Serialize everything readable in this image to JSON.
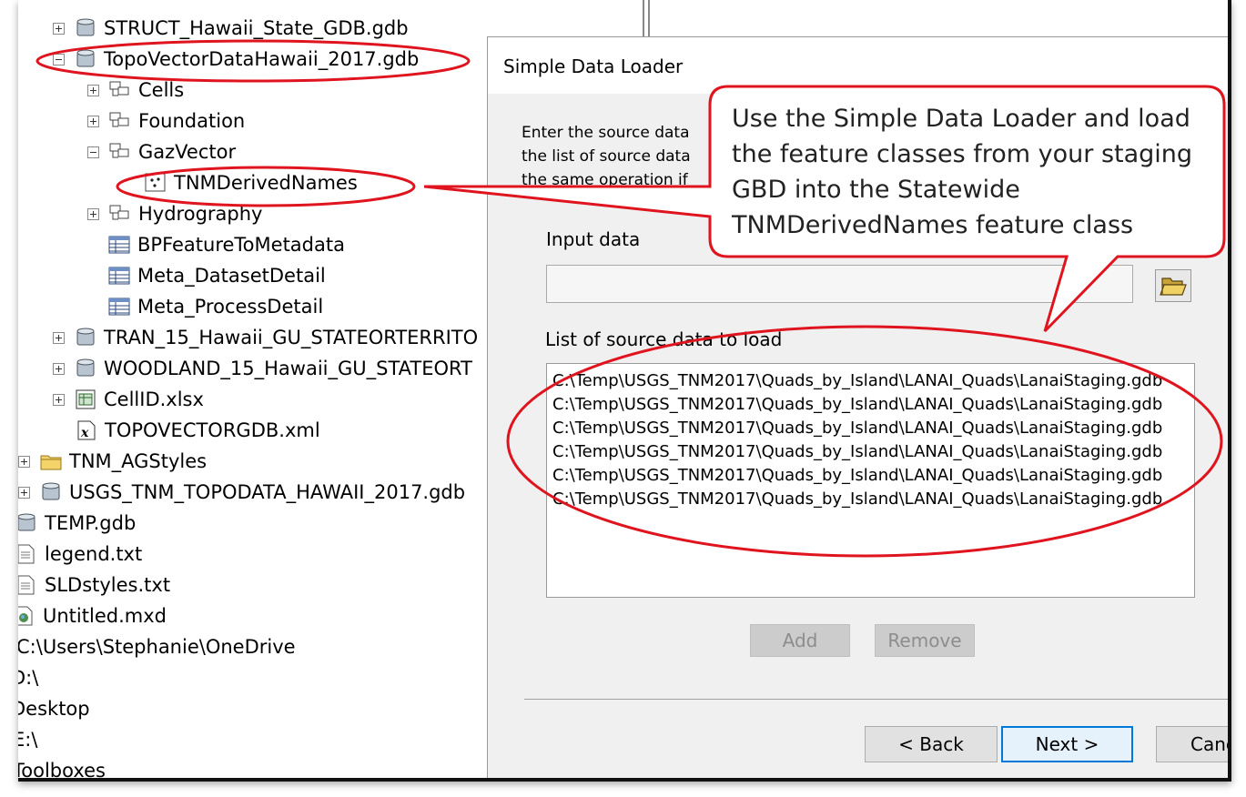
{
  "tree": {
    "items": [
      {
        "label": "STRUCT_Hawaii_State_GDB.gdb",
        "expander": "plus",
        "icon": "geodatabase-icon"
      },
      {
        "label": "TopoVectorDataHawaii_2017.gdb",
        "expander": "minus",
        "icon": "geodatabase-icon"
      },
      {
        "label": "Cells",
        "expander": "plus",
        "icon": "feature-dataset-icon"
      },
      {
        "label": "Foundation",
        "expander": "plus",
        "icon": "feature-dataset-icon"
      },
      {
        "label": "GazVector",
        "expander": "minus",
        "icon": "feature-dataset-icon"
      },
      {
        "label": "TNMDerivedNames",
        "expander": "none",
        "icon": "point-feature-class-icon"
      },
      {
        "label": "Hydrography",
        "expander": "plus",
        "icon": "feature-dataset-icon"
      },
      {
        "label": "BPFeatureToMetadata",
        "expander": "none",
        "icon": "table-icon"
      },
      {
        "label": "Meta_DatasetDetail",
        "expander": "none",
        "icon": "table-icon"
      },
      {
        "label": "Meta_ProcessDetail",
        "expander": "none",
        "icon": "table-icon"
      },
      {
        "label": "TRAN_15_Hawaii_GU_STATEORTERRITO",
        "expander": "plus",
        "icon": "geodatabase-icon"
      },
      {
        "label": "WOODLAND_15_Hawaii_GU_STATEORT",
        "expander": "plus",
        "icon": "geodatabase-icon"
      },
      {
        "label": "CellID.xlsx",
        "expander": "plus",
        "icon": "excel-file-icon"
      },
      {
        "label": "TOPOVECTORGDB.xml",
        "expander": "none",
        "icon": "xml-file-icon"
      },
      {
        "label": "TNM_AGStyles",
        "expander": "plus",
        "icon": "folder-icon"
      },
      {
        "label": "USGS_TNM_TOPODATA_HAWAII_2017.gdb",
        "expander": "plus",
        "icon": "geodatabase-icon"
      },
      {
        "label": "TEMP.gdb",
        "expander": "none",
        "icon": "geodatabase-icon"
      },
      {
        "label": "legend.txt",
        "expander": "none",
        "icon": "text-file-icon"
      },
      {
        "label": "SLDstyles.txt",
        "expander": "none",
        "icon": "text-file-icon"
      },
      {
        "label": "Untitled.mxd",
        "expander": "none",
        "icon": "map-document-icon"
      },
      {
        "label": "C:\\Users\\Stephanie\\OneDrive",
        "expander": "none",
        "icon": "none"
      },
      {
        "label": "D:\\",
        "expander": "none",
        "icon": "none"
      },
      {
        "label": "Desktop",
        "expander": "none",
        "icon": "none"
      },
      {
        "label": "E:\\",
        "expander": "none",
        "icon": "none"
      },
      {
        "label": "Toolboxes",
        "expander": "none",
        "icon": "none"
      }
    ]
  },
  "dialog": {
    "title": "Simple Data Loader",
    "instructions": "Enter the source data\nthe list of source data\nthe same operation if",
    "input_label": "Input data",
    "input_value": "",
    "list_label": "List of source data to load",
    "list_items": [
      "C:\\Temp\\USGS_TNM2017\\Quads_by_Island\\LANAI_Quads\\LanaiStaging.gdb",
      "C:\\Temp\\USGS_TNM2017\\Quads_by_Island\\LANAI_Quads\\LanaiStaging.gdb",
      "C:\\Temp\\USGS_TNM2017\\Quads_by_Island\\LANAI_Quads\\LanaiStaging.gdb",
      "C:\\Temp\\USGS_TNM2017\\Quads_by_Island\\LANAI_Quads\\LanaiStaging.gdb",
      "C:\\Temp\\USGS_TNM2017\\Quads_by_Island\\LANAI_Quads\\LanaiStaging.gdb",
      "C:\\Temp\\USGS_TNM2017\\Quads_by_Island\\LANAI_Quads\\LanaiStaging.gdb"
    ],
    "add_label": "Add",
    "remove_label": "Remove",
    "back_label": "< Back",
    "next_label": "Next >",
    "cancel_label": "Cancel"
  },
  "callout": {
    "text": "Use the Simple Data Loader and load the feature classes from your staging GBD  into the Statewide TNMDerivedNames feature class"
  },
  "colors": {
    "annotation_red": "#e0141e",
    "dialog_background": "#f0f0f0",
    "focus_blue": "#0078d7"
  }
}
